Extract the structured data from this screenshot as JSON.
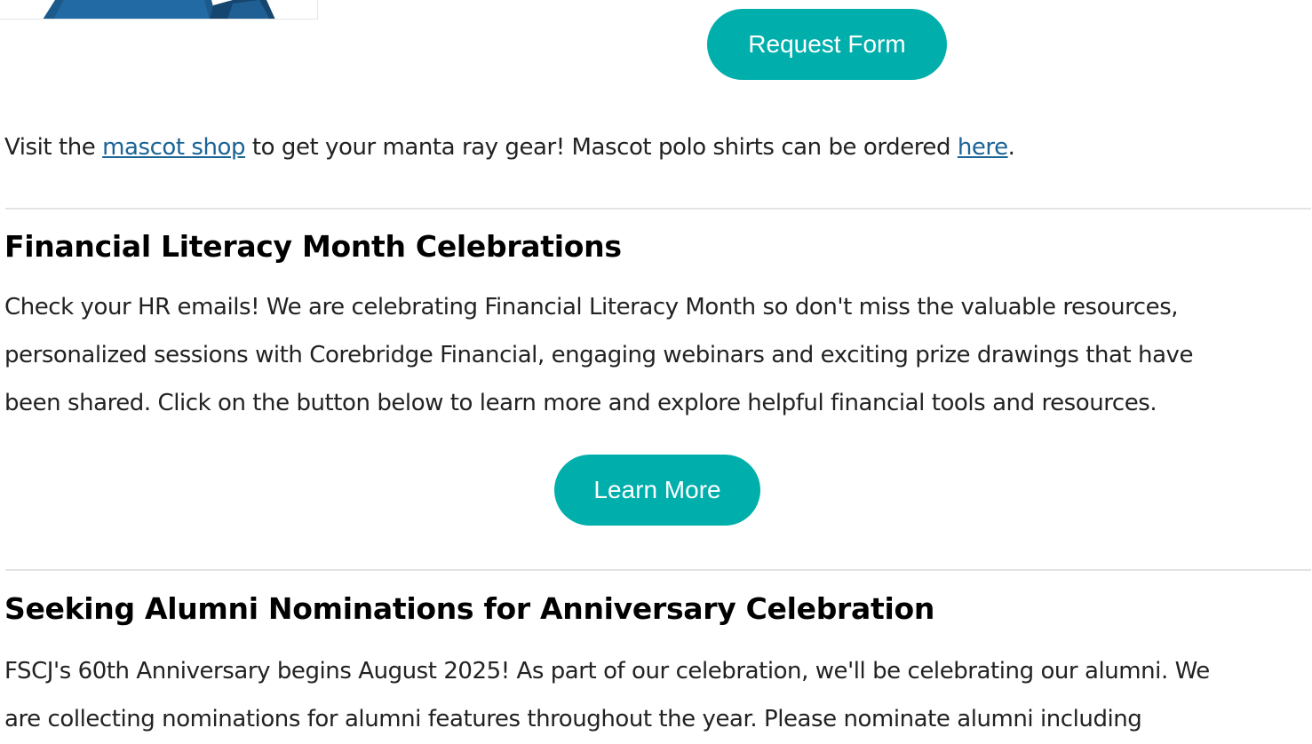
{
  "colors": {
    "accent": "#00aeac",
    "link": "#1a6496",
    "divider": "#e3e3e3"
  },
  "top_section": {
    "image_icon": "person-photo",
    "request_button_label": "Request Form",
    "mascot_para": {
      "prefix": "Visit the ",
      "link1": "mascot shop",
      "middle": " to get your manta ray gear! Mascot polo shirts can be ordered ",
      "link2": "here",
      "suffix": "."
    }
  },
  "financial": {
    "heading": "Financial Literacy Month Celebrations",
    "lines": [
      "Check your HR emails! We are celebrating Financial Literacy Month so don't miss the valuable resources,",
      "personalized sessions with Corebridge Financial, engaging webinars and exciting prize drawings that have",
      "been shared. Click on the button below to learn more and explore helpful financial tools and resources."
    ],
    "button_label": "Learn More"
  },
  "alumni": {
    "heading": "Seeking Alumni Nominations for Anniversary Celebration",
    "lines": [
      "FSCJ's 60th Anniversary begins August 2025! As part of our celebration, we'll be celebrating our alumni. We",
      "are collecting nominations for alumni features throughout the year. Please nominate alumni including"
    ]
  }
}
